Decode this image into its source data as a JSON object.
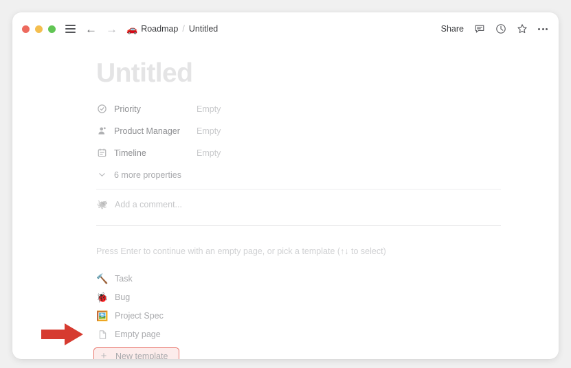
{
  "window": {
    "traffic_lights": [
      "close",
      "minimize",
      "zoom"
    ],
    "colors": {
      "close": "#ED6A5E",
      "minimize": "#F4BE4F",
      "zoom": "#61C554",
      "highlight_border": "#E8736A",
      "highlight_fill": "#FCECEB",
      "arrow": "#D63B30"
    }
  },
  "titlebar": {
    "menu_icon": "hamburger-icon",
    "back_arrow": "←",
    "forward_arrow": "→",
    "breadcrumb": {
      "emoji": "🚗",
      "parent": "Roadmap",
      "separator": "/",
      "current": "Untitled"
    },
    "share_label": "Share",
    "icons": [
      "comment-icon",
      "history-clock-icon",
      "favorite-star-icon",
      "more-options-icon"
    ]
  },
  "page": {
    "title_placeholder": "Untitled",
    "properties": [
      {
        "icon": "select-property-icon",
        "name": "Priority",
        "value": "Empty"
      },
      {
        "icon": "person-property-icon",
        "name": "Product Manager",
        "value": "Empty"
      },
      {
        "icon": "date-property-icon",
        "name": "Timeline",
        "value": "Empty"
      }
    ],
    "more_properties_label": "6 more properties",
    "comment": {
      "avatar_emoji": "🐙",
      "placeholder": "Add a comment..."
    },
    "hint": "Press Enter to continue with an empty page, or pick a template (↑↓ to select)",
    "templates": [
      {
        "icon": "🔨",
        "label": "Task"
      },
      {
        "icon": "🐞",
        "label": "Bug"
      },
      {
        "icon": "🖼️",
        "label": "Project Spec"
      },
      {
        "icon": "page-icon",
        "label": "Empty page"
      }
    ],
    "new_template": {
      "plus": "+",
      "label": "New template"
    }
  }
}
